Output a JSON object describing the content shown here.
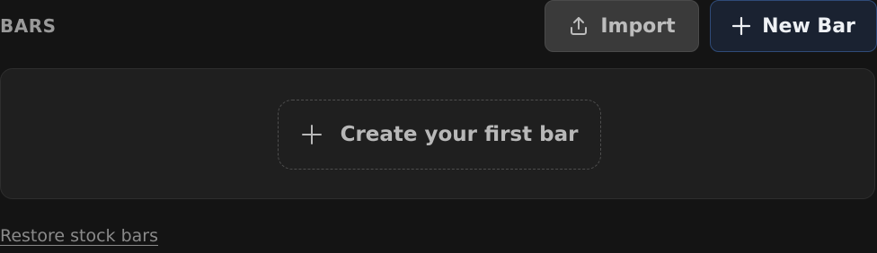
{
  "header": {
    "title": "BARS",
    "import_label": "Import",
    "import_icon": "upload-icon",
    "new_bar_label": "New Bar",
    "new_bar_icon": "plus-icon"
  },
  "empty_state": {
    "create_label": "Create your first bar",
    "create_icon": "plus-icon"
  },
  "footer": {
    "restore_label": "Restore stock bars"
  },
  "colors": {
    "background": "#141414",
    "panel": "#1f1f1f",
    "import_button": "#3a3a3a",
    "new_bar_button": "#1a2231",
    "new_bar_border": "#2f4b78"
  }
}
